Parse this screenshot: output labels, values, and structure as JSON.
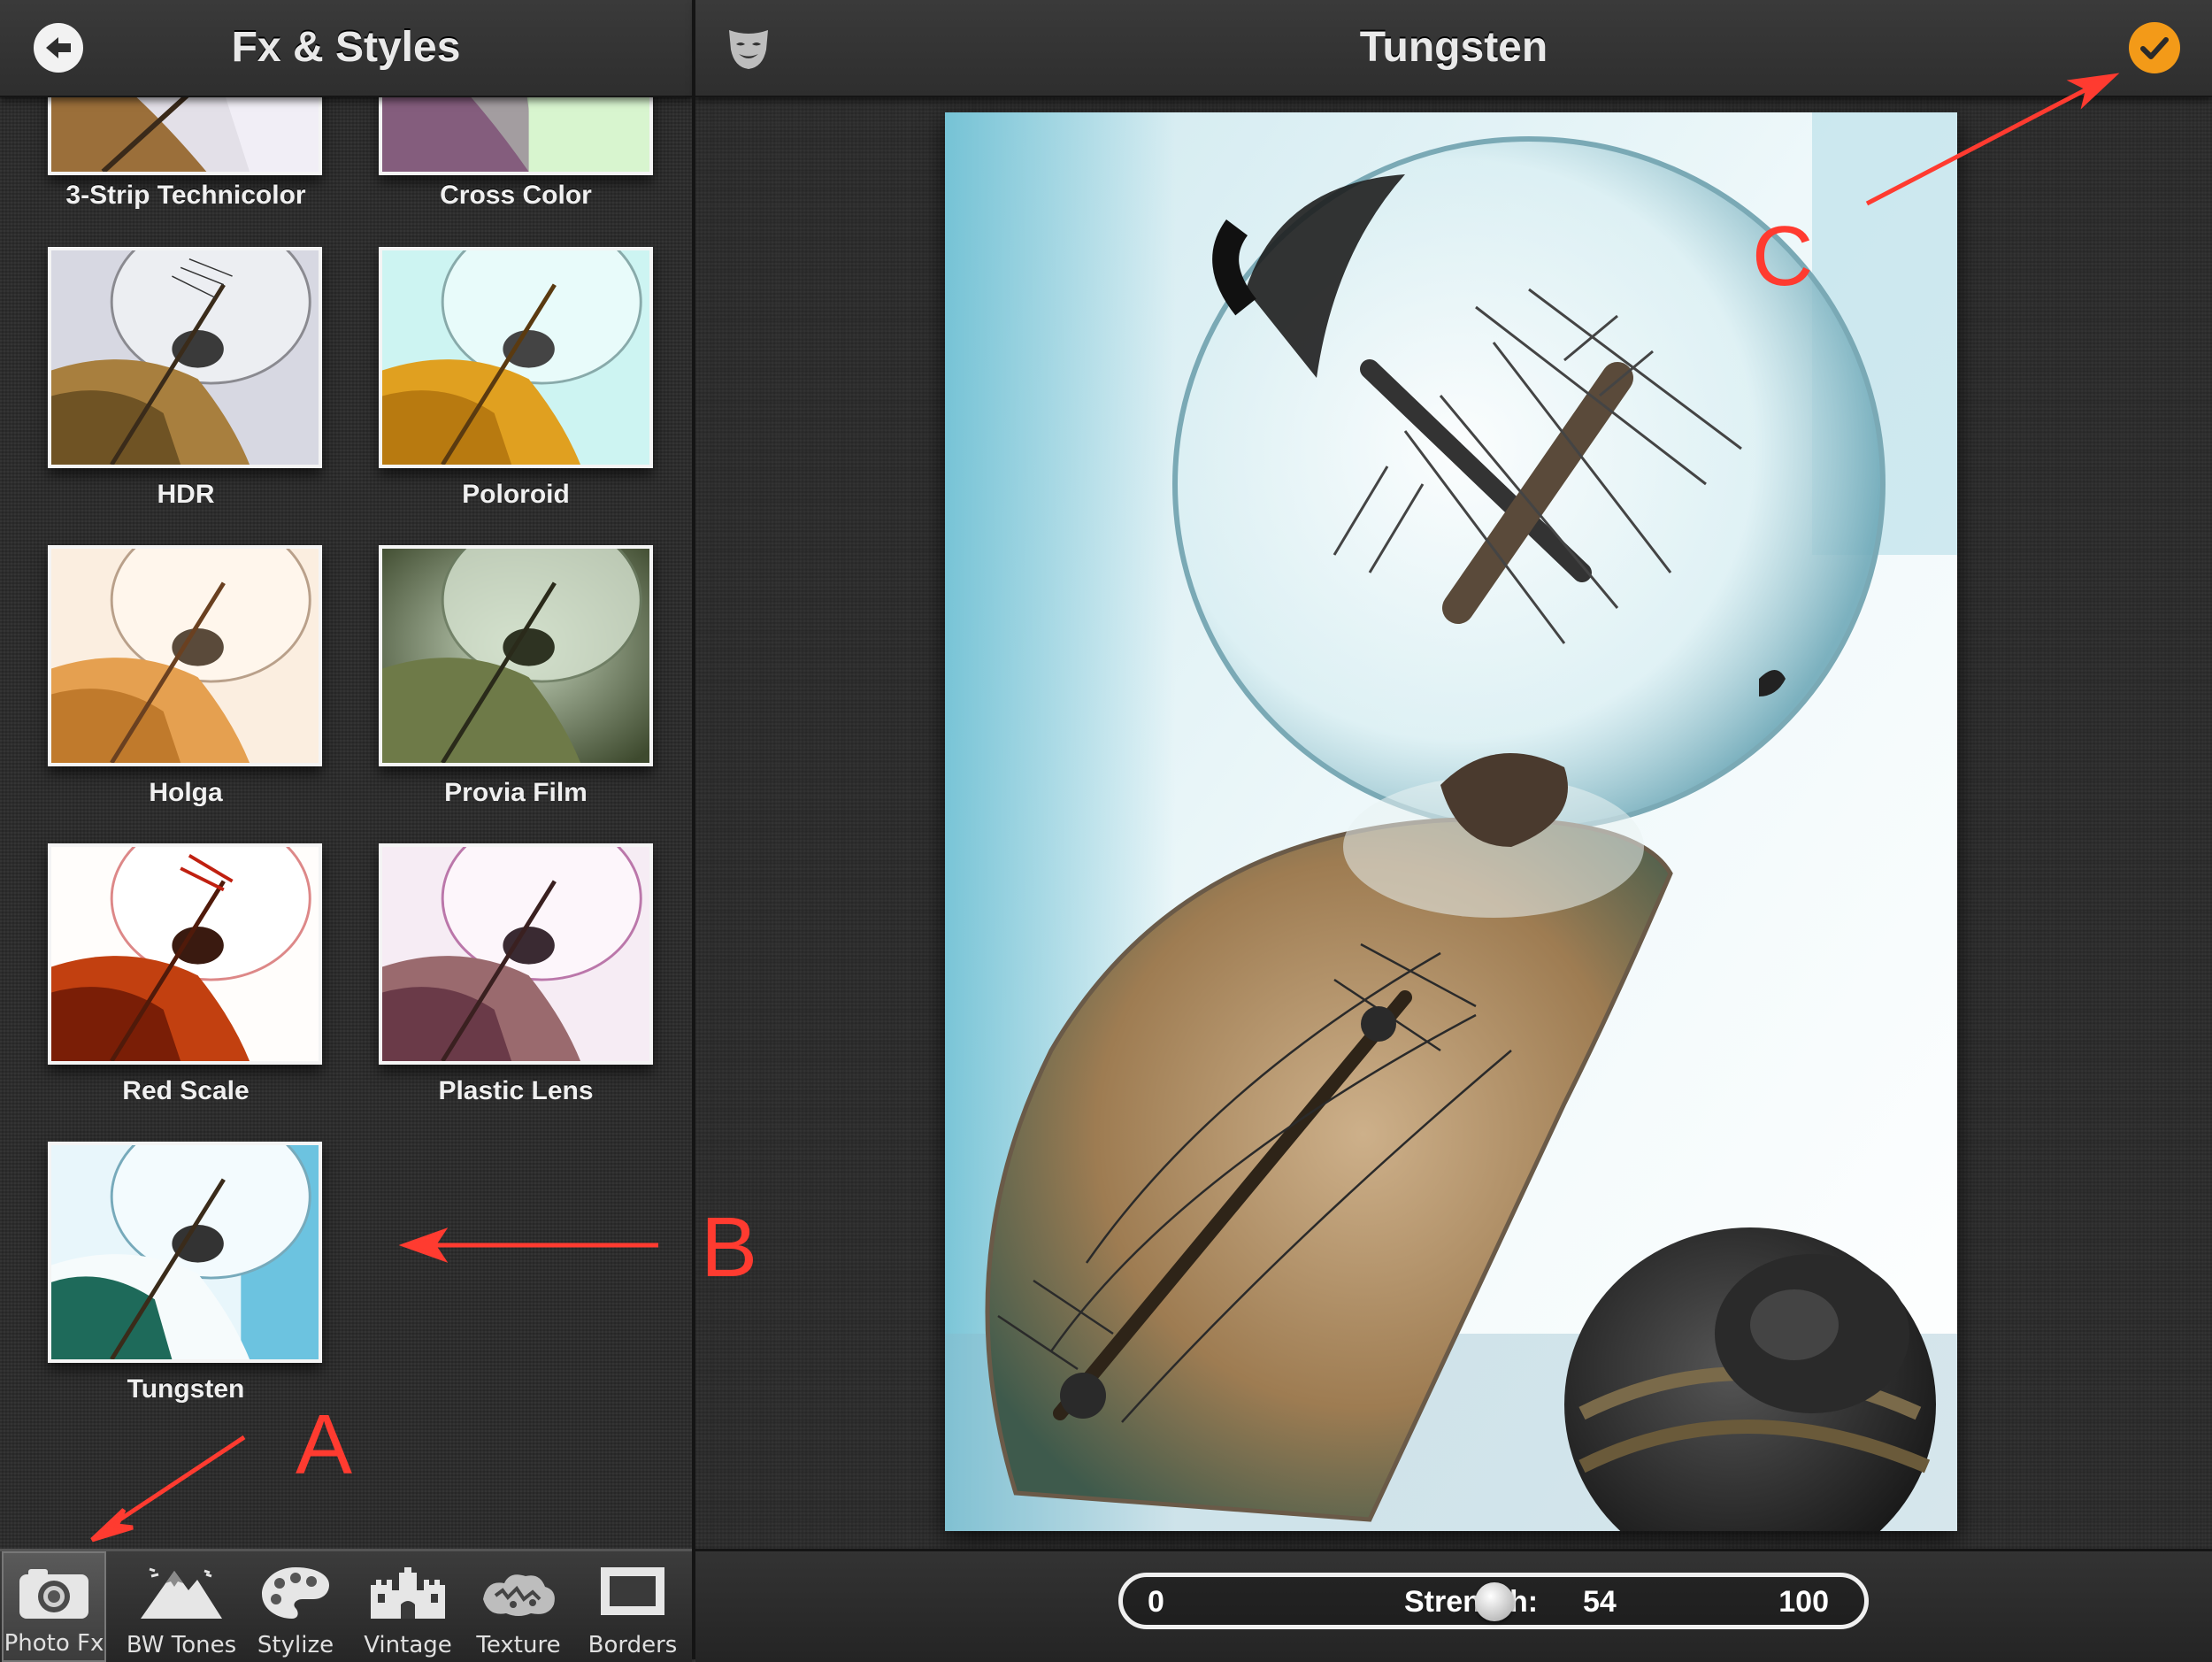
{
  "left_header": {
    "title": "Fx & Styles"
  },
  "right_header": {
    "title": "Tungsten"
  },
  "filters": [
    {
      "label": "3-Strip Technicolor"
    },
    {
      "label": "Cross Color"
    },
    {
      "label": "HDR"
    },
    {
      "label": "Poloroid"
    },
    {
      "label": "Holga"
    },
    {
      "label": "Provia Film"
    },
    {
      "label": "Red Scale"
    },
    {
      "label": "Plastic Lens"
    },
    {
      "label": "Tungsten"
    }
  ],
  "tabs": [
    {
      "label": "Photo Fx",
      "icon": "camera-icon"
    },
    {
      "label": "BW Tones",
      "icon": "mountain-icon"
    },
    {
      "label": "Stylize",
      "icon": "palette-icon"
    },
    {
      "label": "Vintage",
      "icon": "castle-icon"
    },
    {
      "label": "Texture",
      "icon": "texture-icon"
    },
    {
      "label": "Borders",
      "icon": "frame-icon"
    }
  ],
  "slider": {
    "min": "0",
    "max": "100",
    "label": "Strength:",
    "value": "54",
    "fraction": 0.54
  },
  "annotations": {
    "a": "A",
    "b": "B",
    "c": "C"
  },
  "colors": {
    "accent": "#f39a18",
    "annotation": "#ff3b30"
  }
}
